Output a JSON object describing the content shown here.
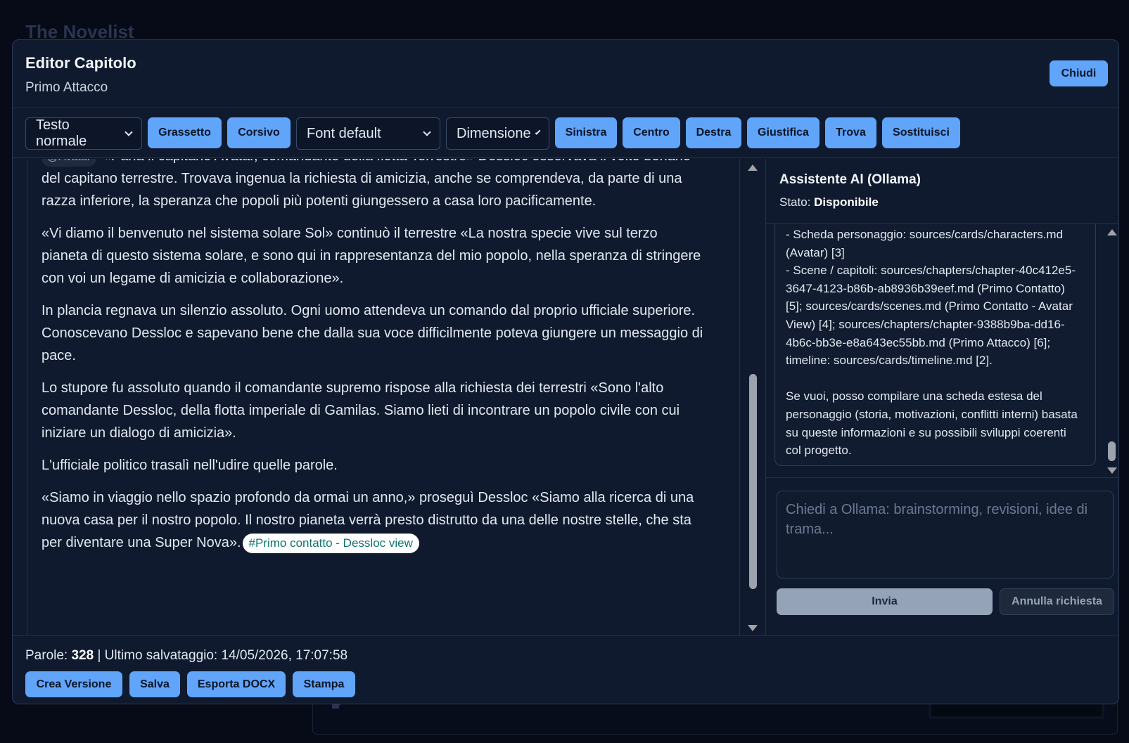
{
  "app": {
    "title": "The Novelist"
  },
  "modal": {
    "title": "Editor Capitolo",
    "subtitle": "Primo Attacco",
    "close_label": "Chiudi"
  },
  "toolbar": {
    "style_select": "Testo normale",
    "bold": "Grassetto",
    "italic": "Corsivo",
    "font_select": "Font default",
    "size_select": "Dimensione",
    "align_left": "Sinistra",
    "align_center": "Centro",
    "align_right": "Destra",
    "justify": "Giustifica",
    "find": "Trova",
    "replace": "Sostituisci"
  },
  "editor": {
    "mention": "@Avatar",
    "paragraphs": [
      "«Parla il capitano Avatar, comandante della flotta Terrestre» Dessloc osservava il volto bonario del capitano terrestre. Trovava ingenua la richiesta di amicizia, anche se comprendeva, da parte di una razza inferiore, la speranza che popoli più potenti giungessero a casa loro pacificamente.",
      "«Vi diamo il benvenuto nel sistema solare Sol» continuò il terrestre «La nostra specie vive sul terzo pianeta di questo sistema solare, e sono qui in rappresentanza del mio popolo, nella speranza di stringere con voi un legame di amicizia e collaborazione».",
      "In plancia regnava un silenzio assoluto. Ogni uomo attendeva un comando dal proprio ufficiale superiore. Conoscevano Dessloc e sapevano bene che dalla sua voce difficilmente poteva giungere un messaggio di pace.",
      "Lo stupore fu assoluto quando il comandante supremo rispose alla richiesta dei terrestri «Sono l'alto comandante Dessloc, della flotta imperiale di Gamilas. Siamo lieti di incontrare un popolo civile con cui iniziare un dialogo di amicizia».",
      "L'ufficiale politico trasalì nell'udire quelle parole.",
      "«Siamo in viaggio nello spazio profondo da ormai un anno,» proseguì Dessloc «Siamo alla ricerca di una nuova casa per il nostro popolo. Il nostro pianeta verrà presto distrutto da una delle nostre stelle, che sta per diventare una Super Nova»."
    ],
    "tag": "#Primo contatto - Dessloc view"
  },
  "ai": {
    "title": "Assistente AI (Ollama)",
    "status_label": "Stato:",
    "status_value": "Disponibile",
    "message": "- Scheda personaggio: sources/cards/characters.md (Avatar) [3]\n- Scene / capitoli: sources/chapters/chapter-40c412e5-3647-4123-b86b-ab8936b39eef.md (Primo Contatto) [5]; sources/cards/scenes.md (Primo Contatto - Avatar View) [4]; sources/chapters/chapter-9388b9ba-dd16-4b6c-bb3e-e8a643ec55bb.md (Primo Attacco) [6]; timeline: sources/cards/timeline.md [2].\n\nSe vuoi, posso compilare una scheda estesa del personaggio (storia, motivazioni, conflitti interni) basata su queste informazioni e su possibili sviluppi coerenti col progetto.",
    "input_placeholder": "Chiedi a Ollama: brainstorming, revisioni, idee di trama...",
    "send_label": "Invia",
    "cancel_label": "Annulla richiesta"
  },
  "footer": {
    "words_label": "Parole:",
    "words_count": "328",
    "saved_text": "| Ultimo salvataggio: 14/05/2026, 17:07:58",
    "create_version": "Crea Versione",
    "save": "Salva",
    "export_docx": "Esporta DOCX",
    "print": "Stampa"
  }
}
